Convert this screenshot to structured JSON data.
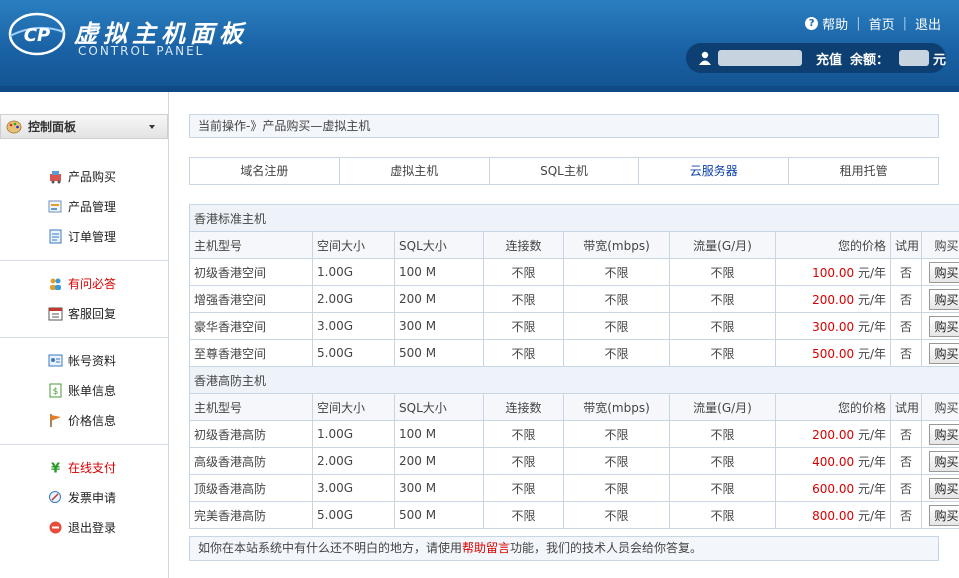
{
  "header": {
    "logo_text": "CP",
    "title": "虚拟主机面板",
    "subtitle": "CONTROL PANEL",
    "help": "帮助",
    "home": "首页",
    "logout": "退出",
    "separator": "|",
    "recharge": "充值",
    "balance_label": "余额：",
    "balance_unit": "元"
  },
  "sidebar": {
    "panel_title": "控制面板",
    "groups": [
      [
        {
          "label": "产品购买",
          "icon": "cart-icon"
        },
        {
          "label": "产品管理",
          "icon": "manage-icon"
        },
        {
          "label": "订单管理",
          "icon": "order-icon"
        }
      ],
      [
        {
          "label": "有问必答",
          "icon": "users-icon",
          "highlight": true
        },
        {
          "label": "客服回复",
          "icon": "calendar-icon"
        }
      ],
      [
        {
          "label": "帐号资料",
          "icon": "profile-icon"
        },
        {
          "label": "账单信息",
          "icon": "bill-icon"
        },
        {
          "label": "价格信息",
          "icon": "flag-icon"
        }
      ],
      [
        {
          "label": "在线支付",
          "icon": "yen-icon",
          "highlight": true
        },
        {
          "label": "发票申请",
          "icon": "invoice-icon"
        },
        {
          "label": "退出登录",
          "icon": "exit-icon"
        }
      ]
    ]
  },
  "breadcrumb": "当前操作-》产品购买—虚拟主机",
  "tabs": [
    "域名注册",
    "虚拟主机",
    "SQL主机",
    "云服务器",
    "租用托管"
  ],
  "columns": [
    "主机型号",
    "空间大小",
    "SQL大小",
    "连接数",
    "带宽(mbps)",
    "流量(G/月)",
    "您的价格",
    "试用",
    "购买"
  ],
  "sections": [
    {
      "title": "香港标准主机",
      "rows": [
        {
          "name": "初级香港空间",
          "space": "1.00G",
          "sql": "100 M",
          "conn": "不限",
          "bw": "不限",
          "traffic": "不限",
          "price": "100.00",
          "unit": "元/年",
          "trial": "否",
          "buy": "购买"
        },
        {
          "name": "增强香港空间",
          "space": "2.00G",
          "sql": "200 M",
          "conn": "不限",
          "bw": "不限",
          "traffic": "不限",
          "price": "200.00",
          "unit": "元/年",
          "trial": "否",
          "buy": "购买"
        },
        {
          "name": "豪华香港空间",
          "space": "3.00G",
          "sql": "300 M",
          "conn": "不限",
          "bw": "不限",
          "traffic": "不限",
          "price": "300.00",
          "unit": "元/年",
          "trial": "否",
          "buy": "购买"
        },
        {
          "name": "至尊香港空间",
          "space": "5.00G",
          "sql": "500 M",
          "conn": "不限",
          "bw": "不限",
          "traffic": "不限",
          "price": "500.00",
          "unit": "元/年",
          "trial": "否",
          "buy": "购买"
        }
      ]
    },
    {
      "title": "香港高防主机",
      "rows": [
        {
          "name": "初级香港高防",
          "space": "1.00G",
          "sql": "100 M",
          "conn": "不限",
          "bw": "不限",
          "traffic": "不限",
          "price": "200.00",
          "unit": "元/年",
          "trial": "否",
          "buy": "购买"
        },
        {
          "name": "高级香港高防",
          "space": "2.00G",
          "sql": "200 M",
          "conn": "不限",
          "bw": "不限",
          "traffic": "不限",
          "price": "400.00",
          "unit": "元/年",
          "trial": "否",
          "buy": "购买"
        },
        {
          "name": "顶级香港高防",
          "space": "3.00G",
          "sql": "300 M",
          "conn": "不限",
          "bw": "不限",
          "traffic": "不限",
          "price": "600.00",
          "unit": "元/年",
          "trial": "否",
          "buy": "购买"
        },
        {
          "name": "完美香港高防",
          "space": "5.00G",
          "sql": "500 M",
          "conn": "不限",
          "bw": "不限",
          "traffic": "不限",
          "price": "800.00",
          "unit": "元/年",
          "trial": "否",
          "buy": "购买"
        }
      ]
    }
  ],
  "footer": {
    "before": "如你在本站系统中有什么还不明白的地方，请使用",
    "link": "帮助留言",
    "after": "功能，我们的技术人员会给你答复。"
  },
  "colors": {
    "header_blue": "#1a63a6",
    "price_red": "#d80000",
    "link_blue": "#0a3ea6"
  }
}
